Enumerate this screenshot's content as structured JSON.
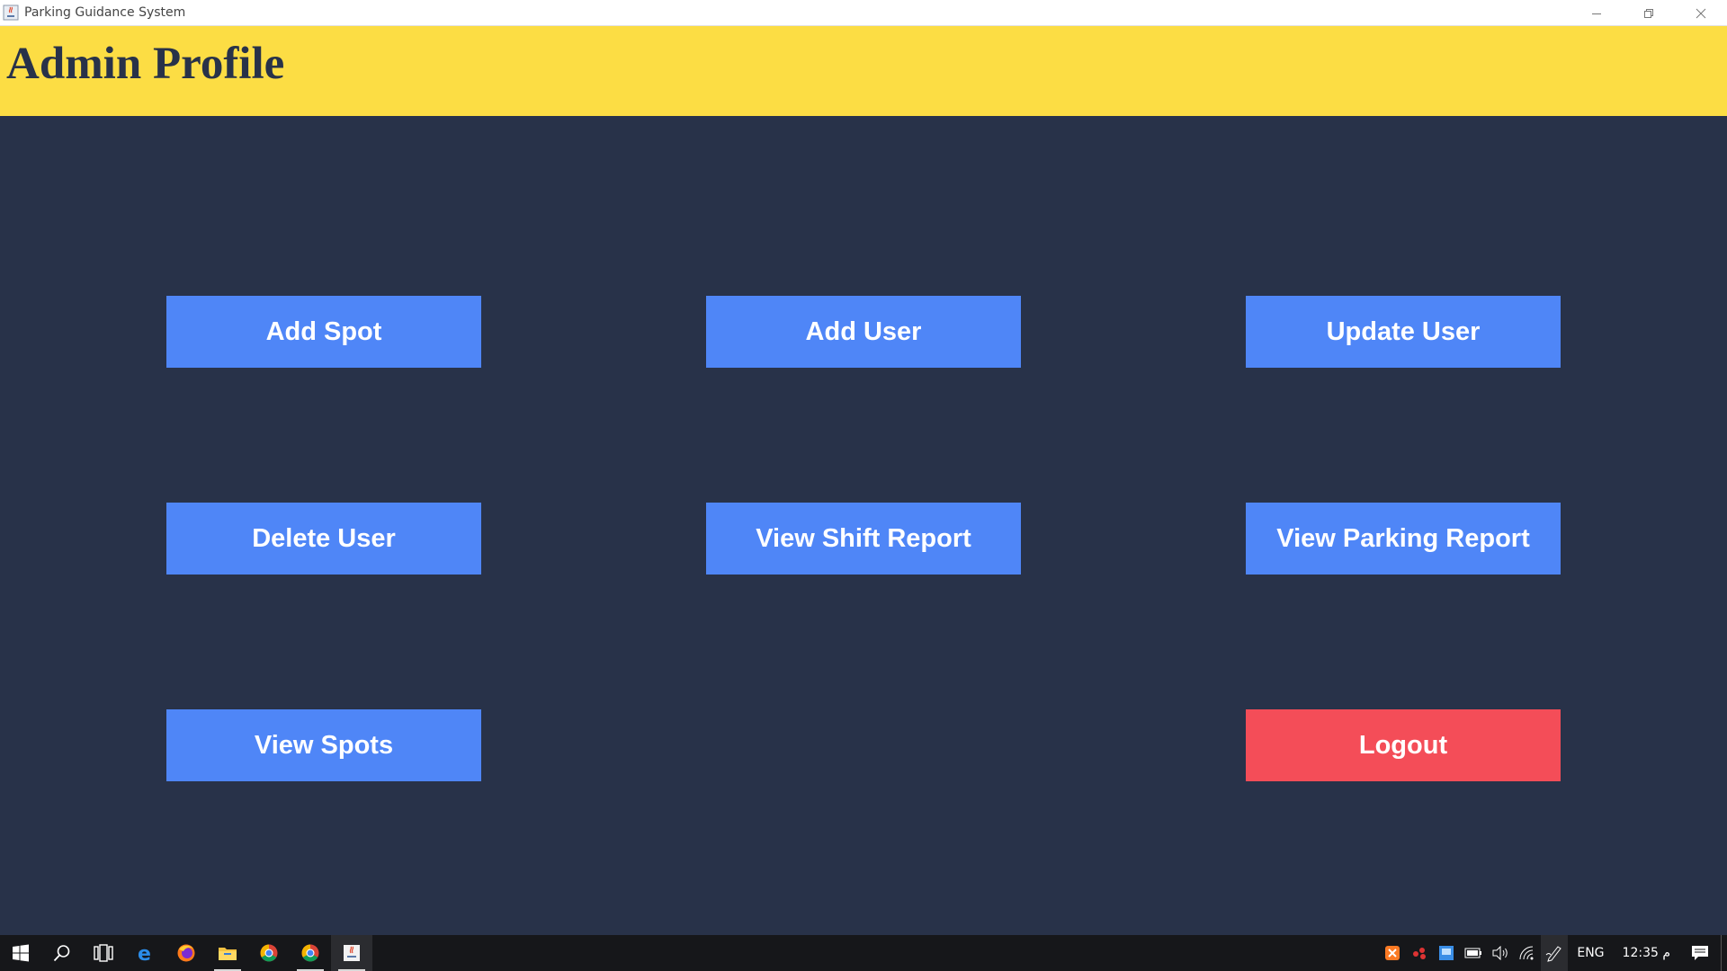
{
  "window": {
    "title": "Parking Guidance System"
  },
  "header": {
    "title": "Admin Profile"
  },
  "buttons": {
    "add_spot": "Add Spot",
    "add_user": "Add User",
    "update_user": "Update User",
    "delete_user": "Delete User",
    "view_shift_report": "View Shift Report",
    "view_parking_report": "View Parking Report",
    "view_spots": "View Spots",
    "logout": "Logout"
  },
  "taskbar": {
    "apps": [
      "windows-start-icon",
      "search-icon",
      "task-view-icon",
      "edge-icon",
      "firefox-icon",
      "file-explorer-icon",
      "chrome-icon",
      "chrome-icon",
      "java-app-icon"
    ],
    "tray": {
      "language": "ENG",
      "time": "12:35 م"
    }
  },
  "colors": {
    "header_bg": "#fcdd44",
    "body_bg": "#283249",
    "button_bg": "#4f86f7",
    "logout_bg": "#f44d58",
    "taskbar_bg": "#16171a"
  }
}
